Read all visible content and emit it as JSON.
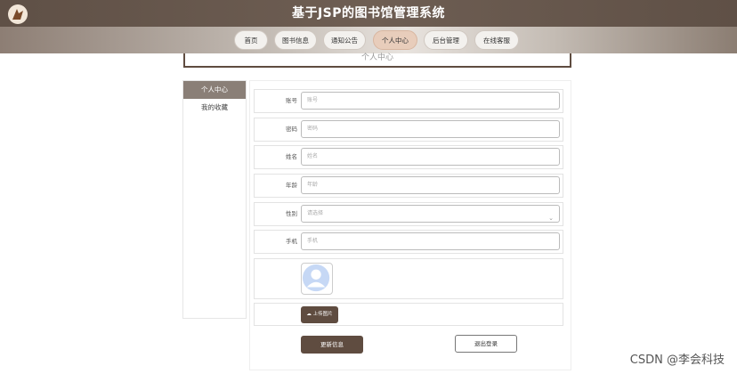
{
  "header": {
    "title": "基于JSP的图书馆管理系统",
    "nav": [
      "首页",
      "图书信息",
      "通知公告",
      "个人中心",
      "后台管理",
      "在线客服"
    ],
    "active_nav": "个人中心"
  },
  "page": {
    "title": "个人中心"
  },
  "sidebar": {
    "items": [
      "个人中心",
      "我的收藏"
    ],
    "active": "个人中心"
  },
  "form": {
    "fields": [
      {
        "label": "账号",
        "placeholder": "账号"
      },
      {
        "label": "密码",
        "placeholder": "密码"
      },
      {
        "label": "姓名",
        "placeholder": "姓名"
      },
      {
        "label": "年龄",
        "placeholder": "年龄"
      },
      {
        "label": "性别",
        "placeholder": "请选择"
      },
      {
        "label": "手机",
        "placeholder": "手机"
      }
    ],
    "upload_label": "上传图片",
    "update_label": "更新信息",
    "logout_label": "退出登录"
  },
  "watermark": "CSDN @李会科技",
  "colors": {
    "brand": "#5f4c40",
    "active_nav": "#e8cdbb",
    "sidebar_active": "#8a7f77"
  }
}
